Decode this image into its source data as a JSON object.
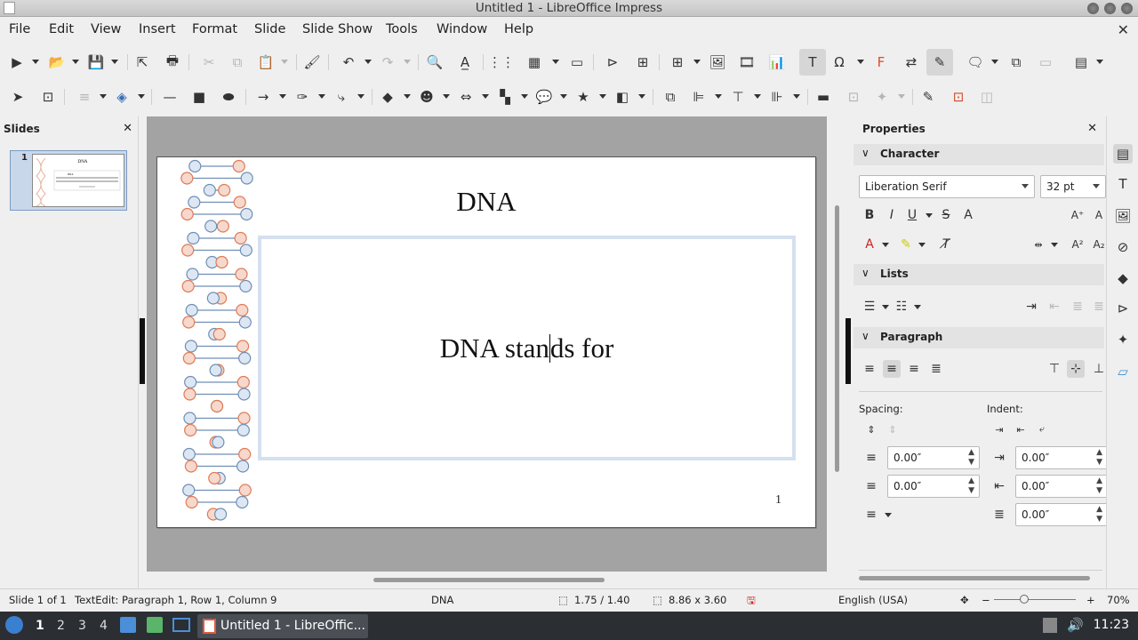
{
  "window": {
    "title": "Untitled 1 - LibreOffice Impress"
  },
  "menu": [
    "File",
    "Edit",
    "View",
    "Insert",
    "Format",
    "Slide",
    "Slide Show",
    "Tools",
    "Window",
    "Help"
  ],
  "slides_panel": {
    "title": "Slides",
    "slide_number": "1"
  },
  "slide": {
    "title": "DNA",
    "body_before_cursor": "DNA stan",
    "body_after_cursor": "ds for",
    "page_number": "1"
  },
  "properties": {
    "title": "Properties",
    "character": {
      "label": "Character",
      "font_name": "Liberation Serif",
      "font_size": "32 pt"
    },
    "lists": {
      "label": "Lists"
    },
    "paragraph": {
      "label": "Paragraph",
      "spacing_label": "Spacing:",
      "indent_label": "Indent:",
      "above_spacing": "0.00″",
      "below_spacing": "0.00″",
      "before_indent": "0.00″",
      "after_indent": "0.00″",
      "first_line_indent": "0.00″"
    }
  },
  "statusbar": {
    "slide_info": "Slide 1 of 1",
    "edit_info": "TextEdit: Paragraph 1, Row 1, Column 9",
    "layout_name": "DNA",
    "position": "1.75 / 1.40",
    "size": "8.86 x 3.60",
    "language": "English (USA)",
    "zoom": "70%"
  },
  "taskbar": {
    "workspaces": [
      "1",
      "2",
      "3",
      "4"
    ],
    "task_label": "Untitled 1 - LibreOffic...",
    "clock": "11:23"
  },
  "colors": {
    "helix_blue": "#6f8fb5",
    "helix_orange": "#e07a55",
    "selection_border": "#d5e0ef"
  }
}
